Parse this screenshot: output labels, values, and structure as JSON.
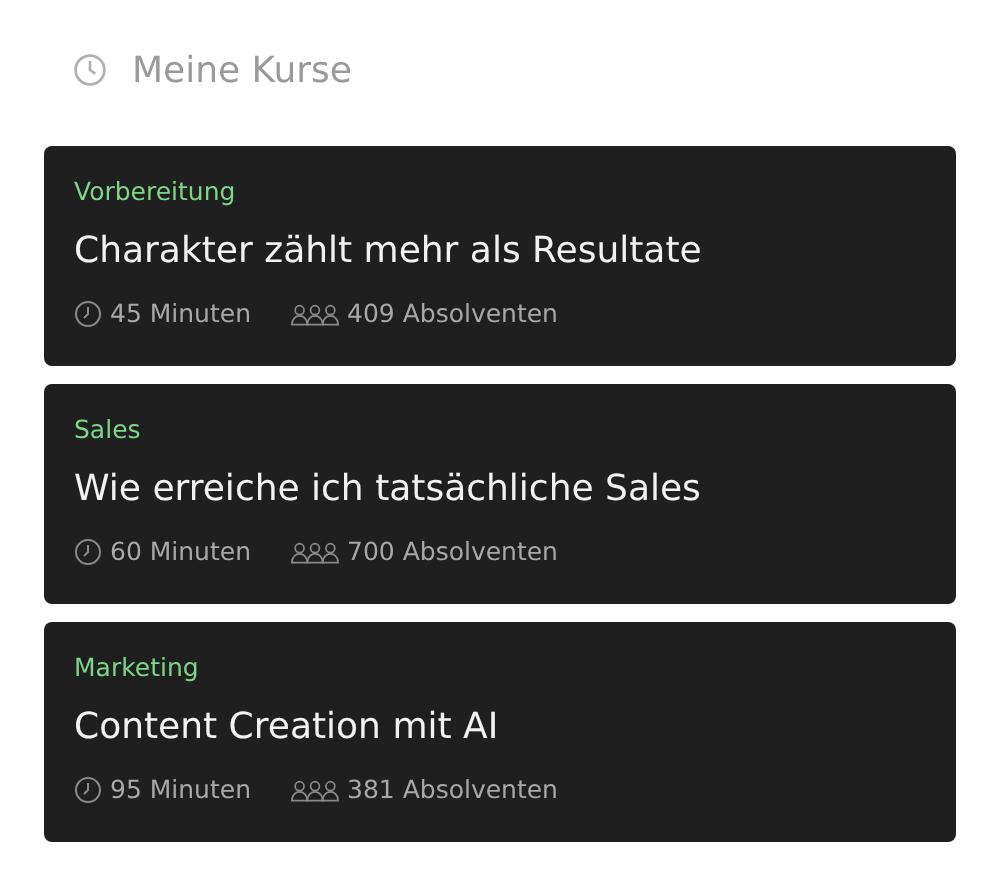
{
  "header": {
    "title": "Meine Kurse"
  },
  "courses": [
    {
      "category": "Vorbereitung",
      "title": "Charakter zählt mehr als Resultate",
      "duration": "45 Minuten",
      "graduates": "409 Absolventen"
    },
    {
      "category": "Sales",
      "title": "Wie erreiche ich tatsächliche Sales",
      "duration": "60 Minuten",
      "graduates": "700 Absolventen"
    },
    {
      "category": "Marketing",
      "title": "Content Creation mit AI",
      "duration": "95 Minuten",
      "graduates": "381 Absolventen"
    }
  ]
}
